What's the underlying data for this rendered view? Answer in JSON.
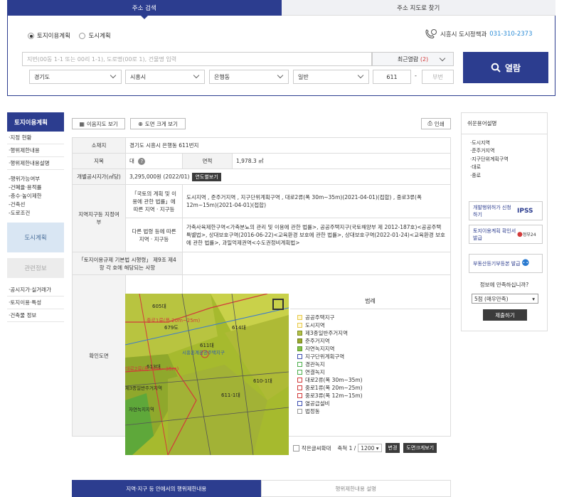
{
  "top_tabs": [
    {
      "label": "주소 검색",
      "active": true
    },
    {
      "label": "주소 지도로 찾기",
      "active": false
    }
  ],
  "search": {
    "radio_land_use": "토지이용계획",
    "radio_city_plan": "도시계획",
    "contact_label": "시흥시 도시정책과",
    "contact_phone": "031-310-2373",
    "address_placeholder": "지번(00동 1-1 또는 00리 1-1), 도로명(00로 1), 건물명 입력",
    "recent_label": "최근열람",
    "recent_count": "(2)",
    "province": "경기도",
    "city": "시흥시",
    "dong": "은행동",
    "land_type": "일반",
    "main_number": "611",
    "sub_number_placeholder": "부번",
    "open_button": "열람"
  },
  "left_nav": {
    "header": "토지이용계획",
    "items": [
      "지정 현황",
      "행위제한내용",
      "행위제한내용설명"
    ],
    "sub_items": [
      "행위가능여부",
      "건폐율·용적률",
      "층수·높이제한",
      "건축선",
      "도로조건"
    ],
    "city_plan": "도시계획",
    "related": "관련정보",
    "info_items": [
      "공시지가·실거래가",
      "토지이용·특성",
      "건축물 정보"
    ]
  },
  "toolbar": {
    "legend_map_btn": "이음지도 보기",
    "zoom_map_btn": "도면 크게 보기",
    "print_btn": "인쇄"
  },
  "info": {
    "location_label": "소재지",
    "location_value": "경기도 시흥시 은행동 611번지",
    "category_label": "지목",
    "category_value": "대",
    "area_label": "면적",
    "area_value": "1,978.3 ㎡",
    "price_label": "개별공시지가(㎡당)",
    "price_value": "3,295,000원 (2022/01)",
    "price_btn": "연도별보기",
    "zone_label": "지역지구등 지정여부",
    "zone_law1_label": "「국토의 계획 및 이용에 관한 법률」에 따른 지역 · 지구등",
    "zone_law1_value": "도시지역 , 준주거지역 , 지구단위계획구역 , 대로2류(폭 30m~35m)(2021-04-01)(접합) , 중로3류(폭 12m~15m)(2021-04-01)(접합)",
    "zone_law2_label": "다른 법령 등에 따른 지역 · 지구등",
    "zone_law2_value": "가축사육제한구역<가축분뇨의 관리 및 이용에 관한 법률>, 공공주택지구(국토해양부 제 2012-187호)<공공주택 특별법>, 상대보호구역(2016-06-22)<교육환경 보호에 관한 법률>, 상대보호구역(2022-01-24)<교육환경 보호에 관한 법률>, 과밀억제권역<수도권정비계획법>",
    "enforcement_label": "「토지이용규제 기본법 시행령」 제9조 제4항 각 호에 해당되는 사항",
    "map_label": "확인도면"
  },
  "legend": {
    "title": "범례",
    "items": [
      {
        "label": "공공주택지구",
        "color": "#e8c84a",
        "fill": "#fff8d0"
      },
      {
        "label": "도시지역",
        "color": "#e8c84a",
        "fill": "#fffbe0"
      },
      {
        "label": "제3종일반주거지역",
        "color": "#7a8c22",
        "fill": "#b6c24a"
      },
      {
        "label": "준주거지역",
        "color": "#6f7d1f",
        "fill": "#9aaa2c"
      },
      {
        "label": "자연녹지지역",
        "color": "#5e9a2e",
        "fill": "#86c24a"
      },
      {
        "label": "지구단위계획구역",
        "color": "#3e4fb0",
        "fill": "#ffffff"
      },
      {
        "label": "경관녹지",
        "color": "#4cae4c",
        "fill": "#ffffff"
      },
      {
        "label": "연결녹지",
        "color": "#4cae4c",
        "fill": "#ffffff"
      },
      {
        "label": "대로2류(폭 30m~35m)",
        "color": "#d23a3a",
        "fill": "#ffffff"
      },
      {
        "label": "중로1류(폭 20m~25m)",
        "color": "#d23a3a",
        "fill": "#ffffff"
      },
      {
        "label": "중로3류(폭 12m~15m)",
        "color": "#d23a3a",
        "fill": "#ffffff"
      },
      {
        "label": "열공급설비",
        "color": "#3e4fb0",
        "fill": "#ffffff"
      },
      {
        "label": "법정동",
        "color": "#999999",
        "fill": "#ffffff"
      }
    ],
    "small_text_label": "작은글씨확대",
    "scale_label": "축척 1 /",
    "scale_value": "1200",
    "change_btn": "변경",
    "zoom_btn": "도면크게보기"
  },
  "map_labels": {
    "l605": "605대",
    "l614a": "614대",
    "l614b": "614대",
    "l611": "611대",
    "l609": "609도",
    "l610": "610-1대",
    "l611_1": "611-1대",
    "l613": "613대",
    "l679": "679도",
    "red1": "중로1류(폭 20m~25m)",
    "red2": "대로2류(폭 30m~35m)",
    "blue1": "시흥은계공공주택지구",
    "gen": "제3종일반주거지역",
    "nat": "자연녹지지역"
  },
  "right_side": {
    "title": "쉬운용어설명",
    "terms": [
      "도시지역",
      "준주거지역",
      "지구단위계획구역",
      "대로",
      "중로"
    ],
    "btn1": "개발행위허가 신청하기",
    "btn1_logo": "IPSS",
    "btn2": "토지이용계획 확인서 발급",
    "btn2_logo": "정부24",
    "btn3": "부동산등기부등본 발급",
    "survey_q": "정보에 만족하십니까?",
    "survey_option": "5점 (매우만족)",
    "submit": "제출하기"
  },
  "bottom_tabs": [
    {
      "label": "지역·지구 등 안에서의 행위제한내용",
      "active": true
    },
    {
      "label": "행위제한내용 설명",
      "active": false
    }
  ]
}
